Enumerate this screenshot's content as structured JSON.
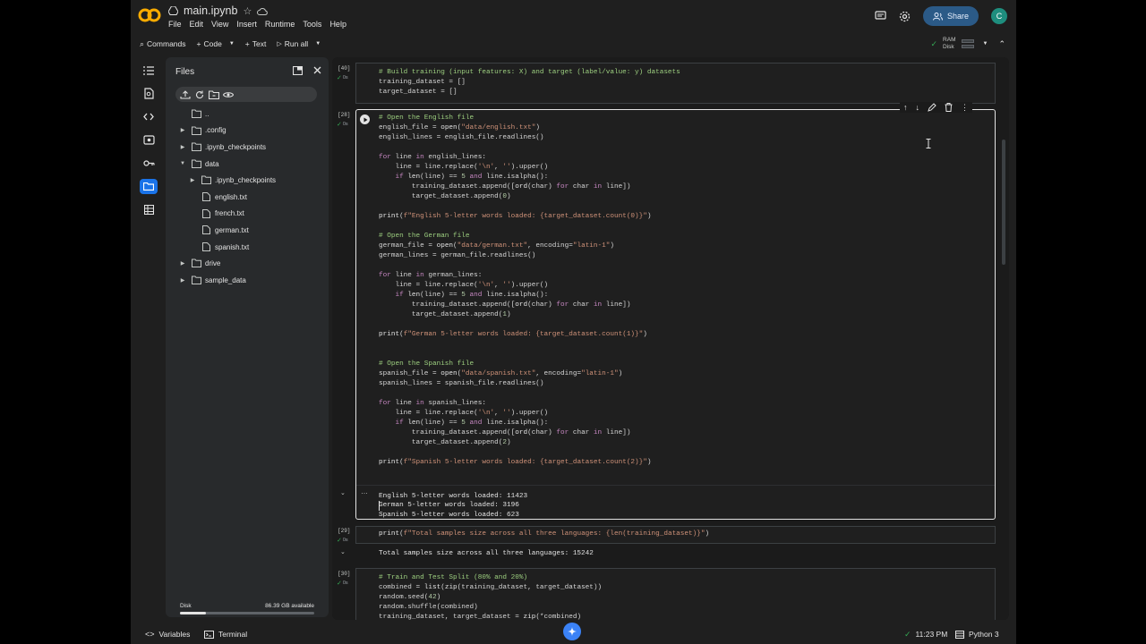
{
  "app": {
    "notebook_title": "main.ipynb",
    "menu": [
      "File",
      "Edit",
      "View",
      "Insert",
      "Runtime",
      "Tools",
      "Help"
    ],
    "share_label": "Share",
    "avatar_letter": "C",
    "accent": "#1a73e8"
  },
  "toolbar": {
    "commands": "Commands",
    "code": "Code",
    "text": "Text",
    "run_all": "Run all",
    "ram_label": "RAM",
    "disk_label": "Disk"
  },
  "files_panel": {
    "title": "Files",
    "tree": [
      {
        "name": "..",
        "indent": 0,
        "type": "folder",
        "caret": ""
      },
      {
        "name": ".config",
        "indent": 0,
        "type": "folder",
        "caret": "▶"
      },
      {
        "name": ".ipynb_checkpoints",
        "indent": 0,
        "type": "folder",
        "caret": "▶"
      },
      {
        "name": "data",
        "indent": 0,
        "type": "folder",
        "caret": "▼"
      },
      {
        "name": ".ipynb_checkpoints",
        "indent": 1,
        "type": "folder",
        "caret": "▶"
      },
      {
        "name": "english.txt",
        "indent": 1,
        "type": "file",
        "caret": ""
      },
      {
        "name": "french.txt",
        "indent": 1,
        "type": "file",
        "caret": ""
      },
      {
        "name": "german.txt",
        "indent": 1,
        "type": "file",
        "caret": ""
      },
      {
        "name": "spanish.txt",
        "indent": 1,
        "type": "file",
        "caret": ""
      },
      {
        "name": "drive",
        "indent": 0,
        "type": "folder",
        "caret": "▶"
      },
      {
        "name": "sample_data",
        "indent": 0,
        "type": "folder",
        "caret": "▶"
      }
    ],
    "disk_label": "Disk",
    "disk_available": "86.39 GB available",
    "disk_used_fraction": 0.19
  },
  "cells": {
    "c40": {
      "count": "[40]",
      "status": "0s",
      "lines": [
        "# Build training (input features: X) and target (label/value: y) datasets",
        "training_dataset = []",
        "target_dataset = []"
      ]
    },
    "c28": {
      "count": "[28]",
      "status": "0s",
      "lines": [
        "# Open the English file",
        "english_file = open(\"data/english.txt\")",
        "english_lines = english_file.readlines()",
        "",
        "for line in english_lines:",
        "    line = line.replace('\\n', '').upper()",
        "    if len(line) == 5 and line.isalpha():",
        "        training_dataset.append([ord(char) for char in line])",
        "        target_dataset.append(0)",
        "",
        "print(f\"English 5-letter words loaded: {target_dataset.count(0)}\")",
        "",
        "# Open the German file",
        "german_file = open(\"data/german.txt\", encoding=\"latin-1\")",
        "german_lines = german_file.readlines()",
        "",
        "for line in german_lines:",
        "    line = line.replace('\\n', '').upper()",
        "    if len(line) == 5 and line.isalpha():",
        "        training_dataset.append([ord(char) for char in line])",
        "        target_dataset.append(1)",
        "",
        "print(f\"German 5-letter words loaded: {target_dataset.count(1)}\")",
        "",
        "",
        "# Open the Spanish file",
        "spanish_file = open(\"data/spanish.txt\", encoding=\"latin-1\")",
        "spanish_lines = spanish_file.readlines()",
        "",
        "for line in spanish_lines:",
        "    line = line.replace('\\n', '').upper()",
        "    if len(line) == 5 and line.isalpha():",
        "        training_dataset.append([ord(char) for char in line])",
        "        target_dataset.append(2)",
        "",
        "print(f\"Spanish 5-letter words loaded: {target_dataset.count(2)}\")"
      ],
      "output": [
        "English 5-letter words loaded: 11423",
        "German 5-letter words loaded: 3196",
        "Spanish 5-letter words loaded: 623"
      ]
    },
    "c29": {
      "count": "[29]",
      "status": "0s",
      "lines": [
        "print(f\"Total samples size across all three languages: {len(training_dataset)}\")"
      ],
      "output": [
        "Total samples size across all three languages: 15242"
      ]
    },
    "c30": {
      "count": "[30]",
      "status": "0s",
      "lines": [
        "# Train and Test Split (80% and 20%)",
        "combined = list(zip(training_dataset, target_dataset))",
        "random.seed(42)",
        "random.shuffle(combined)",
        "training_dataset, target_dataset = zip(*combined)"
      ]
    }
  },
  "statusbar": {
    "variables": "Variables",
    "terminal": "Terminal",
    "time": "11:23 PM",
    "runtime": "Python 3"
  }
}
